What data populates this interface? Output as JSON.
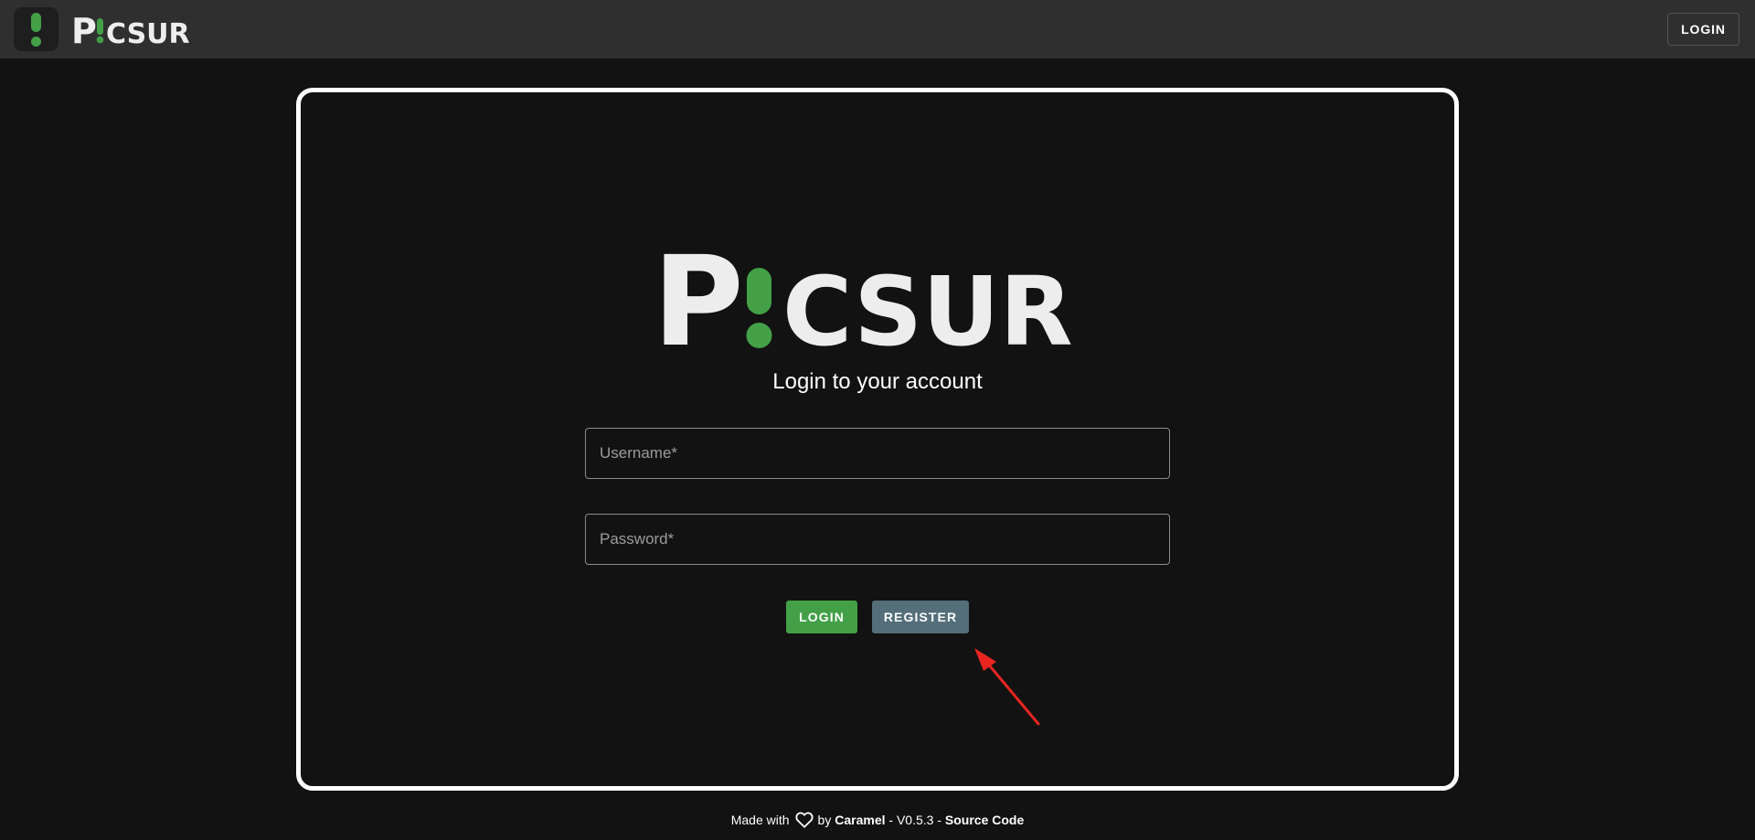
{
  "header": {
    "logo_icon": "exclamation-logo-icon",
    "wordmark_prefix": "P",
    "wordmark_suffix": "CSUR",
    "login_label": "LOGIN"
  },
  "login_card": {
    "logo_prefix": "P",
    "logo_suffix": "CSUR",
    "subtitle": "Login to your account",
    "username_placeholder": "Username*",
    "password_placeholder": "Password*",
    "login_button": "LOGIN",
    "register_button": "REGISTER"
  },
  "footer": {
    "made_with": "Made with",
    "heart_icon": "heart-icon",
    "by": "by",
    "author": "Caramel",
    "sep1": " - ",
    "version": "V0.5.3",
    "sep2": " - ",
    "source_link": "Source Code"
  },
  "colors": {
    "accent_green": "#43a047",
    "register_gray": "#546e7a",
    "background": "#121212",
    "topbar": "#2f2f2f",
    "annotation_arrow": "#e8251f"
  }
}
